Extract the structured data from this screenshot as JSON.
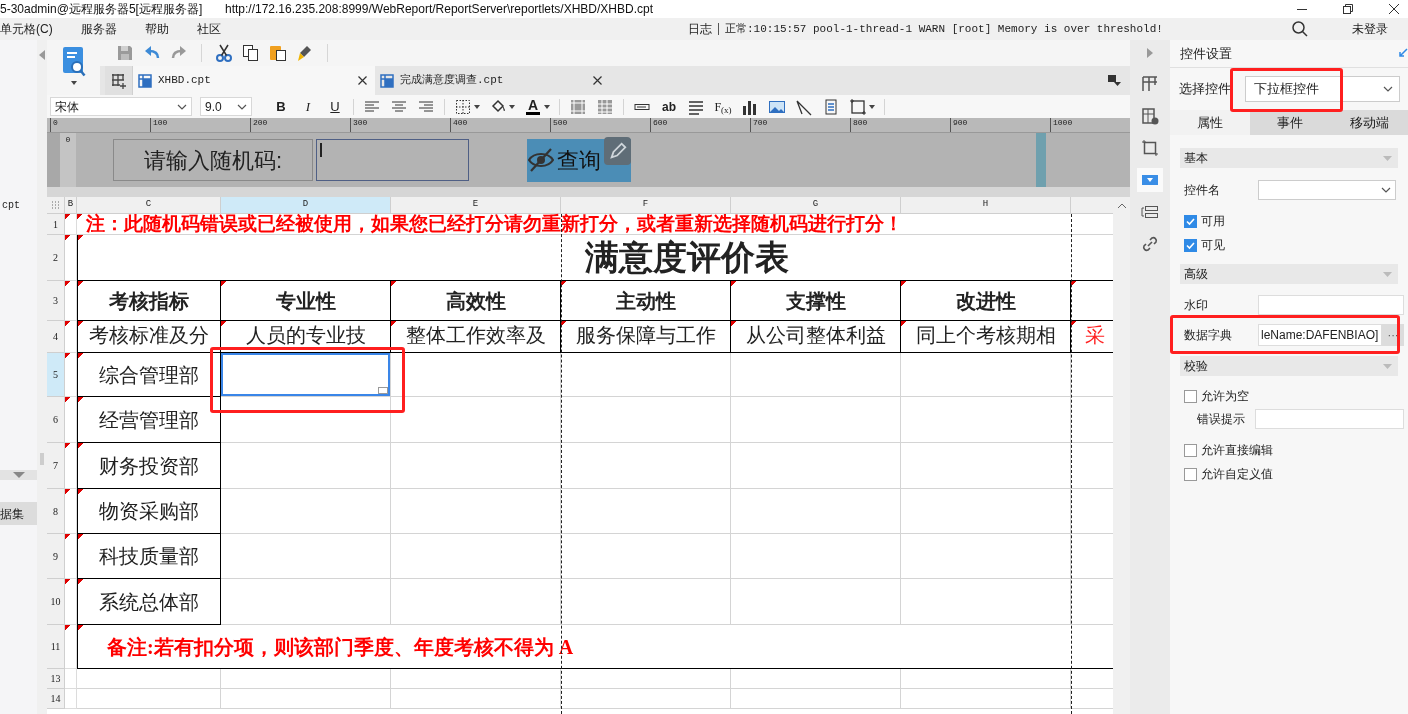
{
  "window": {
    "title": "5-30admin@远程服务器5[远程服务器]",
    "url": "http://172.16.235.208:8999/WebReport/ReportServer\\reportlets/XHBD/XHBD.cpt"
  },
  "menu_bar": {
    "items": [
      "单元格(C)",
      "服务器",
      "帮助",
      "社区"
    ],
    "log_label": "日志",
    "log_message": "正常:10:15:57 pool-1-thread-1 WARN [root] Memory is over threshold!",
    "login": "未登录"
  },
  "left_pane": {
    "items": [
      {
        "label": "cpt",
        "selected": false
      },
      {
        "label": "据集",
        "selected": true
      }
    ]
  },
  "file_tabs": [
    {
      "label": "XHBD.cpt",
      "selected": true
    },
    {
      "label": "完成满意度调查.cpt",
      "selected": false
    }
  ],
  "format_toolbar": {
    "font": "宋体",
    "size": "9.0",
    "bold": "B",
    "italic": "I",
    "underline": "U",
    "font_color": "A",
    "text_field": "ab",
    "formula": "F$_{(x)}$"
  },
  "ruler": [
    "0",
    "100",
    "200",
    "300",
    "400",
    "500",
    "600",
    "700",
    "800",
    "900",
    "1000"
  ],
  "vertical_ruler": "0",
  "parameter_panel": {
    "label": "请输入随机码:",
    "button": "查询"
  },
  "sheet": {
    "columns": [
      {
        "label": "B",
        "selected": false
      },
      {
        "label": "C",
        "selected": false
      },
      {
        "label": "D",
        "selected": true
      },
      {
        "label": "E",
        "selected": false
      },
      {
        "label": "F",
        "selected": false
      },
      {
        "label": "G",
        "selected": false
      },
      {
        "label": "H",
        "selected": false
      }
    ],
    "rows": [
      {
        "number": "1",
        "kind": "note",
        "selected": false,
        "text": "注：此随机码错误或已经被使用，如果您已经打分请勿重新打分，或者重新选择随机码进行打分！"
      },
      {
        "number": "2",
        "kind": "title",
        "selected": false,
        "text": "满意度评价表"
      },
      {
        "number": "3",
        "kind": "header",
        "selected": false,
        "cells": [
          "考核指标",
          "专业性",
          "高效性",
          "主动性",
          "支撑性",
          "改进性"
        ]
      },
      {
        "number": "4",
        "kind": "criteria",
        "selected": false,
        "cells": [
          "考核标准及分",
          "人员的专业技",
          "整体工作效率及",
          "服务保障与工作",
          "从公司整体利益",
          "同上个考核期相"
        ],
        "extra": "采"
      },
      {
        "number": "5",
        "kind": "department",
        "selected": true,
        "label": "综合管理部"
      },
      {
        "number": "6",
        "kind": "department",
        "selected": false,
        "label": "经营管理部"
      },
      {
        "number": "7",
        "kind": "department",
        "selected": false,
        "label": "财务投资部"
      },
      {
        "number": "8",
        "kind": "department",
        "selected": false,
        "label": "物资采购部"
      },
      {
        "number": "9",
        "kind": "department",
        "selected": false,
        "label": "科技质量部"
      },
      {
        "number": "10",
        "kind": "department",
        "selected": false,
        "label": "系统总体部"
      },
      {
        "number": "11",
        "kind": "remark",
        "selected": false,
        "text": "备注:若有扣分项，则该部门季度、年度考核不得为 A"
      },
      {
        "number": "13",
        "kind": "empty",
        "selected": false
      },
      {
        "number": "14",
        "kind": "empty",
        "selected": false
      }
    ]
  },
  "side_tabs": [
    {
      "selected": false
    },
    {
      "selected": false
    },
    {
      "selected": false
    },
    {
      "selected": true
    },
    {
      "selected": false
    },
    {
      "selected": false
    }
  ],
  "settings_panel": {
    "title": "控件设置",
    "select_label": "选择控件",
    "select_value": "下拉框控件",
    "tabs": [
      {
        "label": "属性",
        "selected": true
      },
      {
        "label": "事件",
        "selected": false
      },
      {
        "label": "移动端",
        "selected": false
      }
    ],
    "sections": [
      {
        "title": "基本",
        "items": [
          {
            "kind": "select",
            "label": "控件名"
          },
          {
            "kind": "checkbox",
            "label": "可用",
            "checked": true
          },
          {
            "kind": "checkbox",
            "label": "可见",
            "checked": true
          }
        ]
      },
      {
        "title": "高级",
        "items": [
          {
            "kind": "input",
            "label": "水印"
          },
          {
            "kind": "dict",
            "label": "数据字典",
            "value": "leName:DAFENBIAO]",
            "button": "···"
          }
        ]
      },
      {
        "title": "校验",
        "items": [
          {
            "kind": "checkbox",
            "label": "允许为空",
            "checked": false
          },
          {
            "kind": "subinput",
            "label": "错误提示"
          },
          {
            "kind": "checkbox",
            "label": "允许直接编辑",
            "checked": false
          },
          {
            "kind": "checkbox",
            "label": "允许自定义值",
            "checked": false
          }
        ]
      }
    ]
  }
}
